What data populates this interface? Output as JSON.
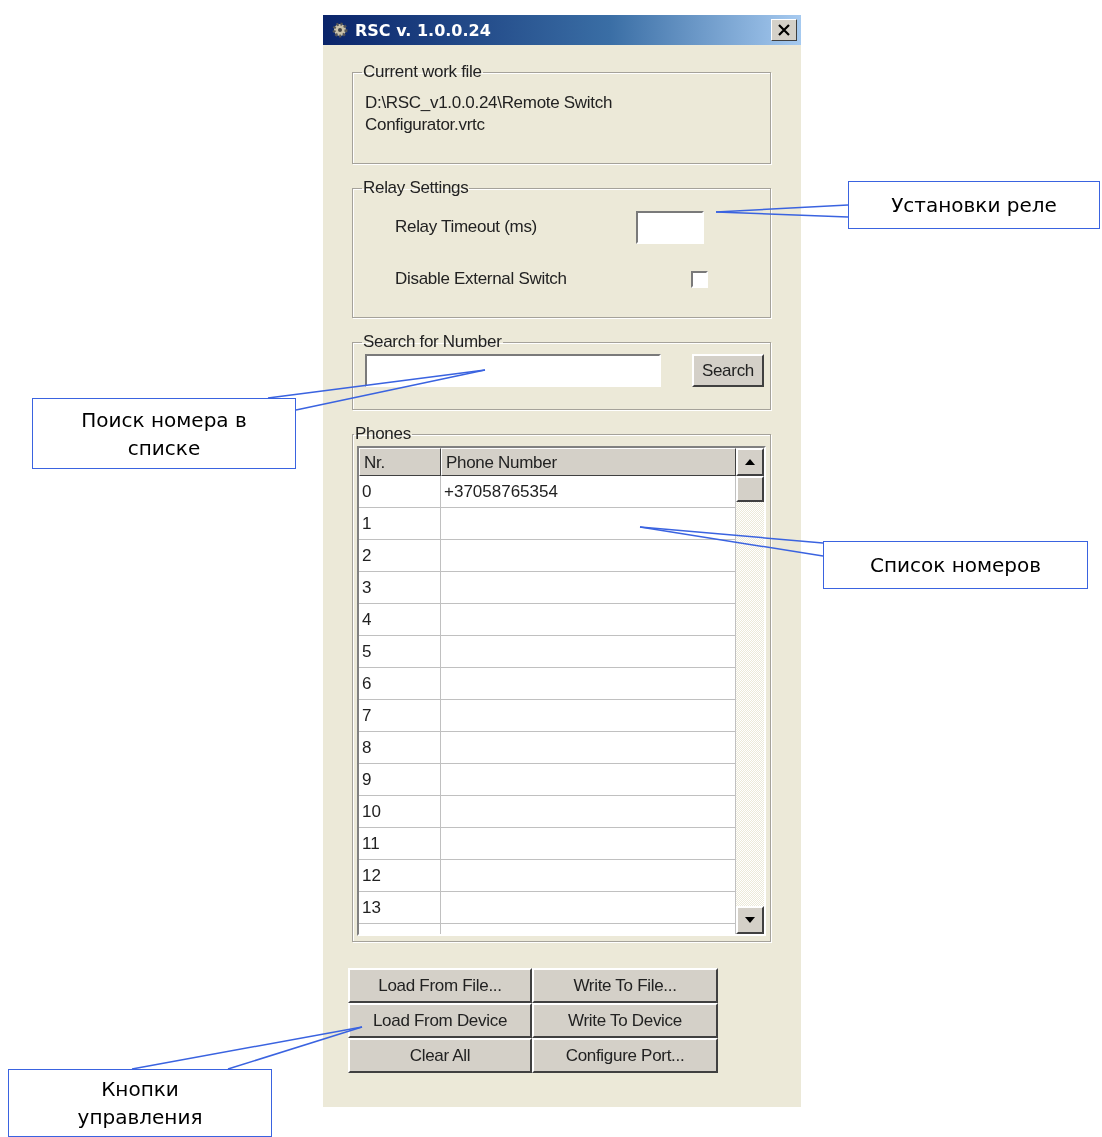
{
  "window": {
    "title": "RSC v. 1.0.0.24"
  },
  "work_file": {
    "legend": "Current work file",
    "path": "D:\\RSC_v1.0.0.24\\Remote Switch Configurator.vrtc"
  },
  "relay_settings": {
    "legend": "Relay Settings",
    "timeout_label": "Relay Timeout (ms)",
    "disable_label": "Disable External Switch",
    "disable_checked": false
  },
  "search": {
    "legend": "Search for Number",
    "button": "Search"
  },
  "phones": {
    "legend": "Phones",
    "columns": [
      "Nr.",
      "Phone Number"
    ],
    "rows": [
      {
        "nr": "0",
        "number": "+37058765354"
      },
      {
        "nr": "1"
      },
      {
        "nr": "2"
      },
      {
        "nr": "3"
      },
      {
        "nr": "4"
      },
      {
        "nr": "5"
      },
      {
        "nr": "6"
      },
      {
        "nr": "7"
      },
      {
        "nr": "8"
      },
      {
        "nr": "9"
      },
      {
        "nr": "10"
      },
      {
        "nr": "11"
      },
      {
        "nr": "12"
      },
      {
        "nr": "13"
      }
    ]
  },
  "buttons": [
    "Load From File...",
    "Write To File...",
    "Load From Device",
    "Write To Device",
    "Clear All",
    "Configure Port..."
  ],
  "callouts": [
    {
      "text": "Установки реле",
      "kind": "relay"
    },
    {
      "text": "Поиск номера в списке",
      "kind": "search"
    },
    {
      "text": "Список номеров",
      "kind": "phones"
    },
    {
      "text": "Кнопки управления",
      "kind": "buttons"
    }
  ]
}
